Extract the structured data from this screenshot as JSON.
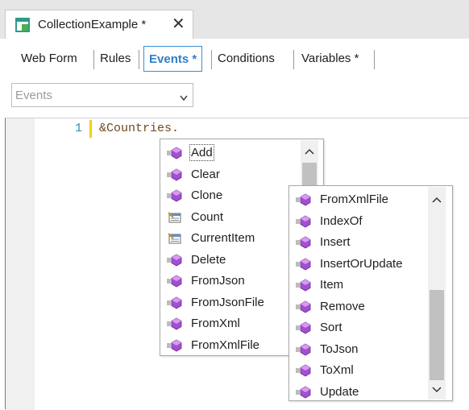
{
  "document_tab": {
    "title": "CollectionExample",
    "modified_marker": "*",
    "close_icon": "close-icon"
  },
  "subtabs": [
    {
      "label": "Web Form"
    },
    {
      "label": "Rules"
    },
    {
      "label": "Events *"
    },
    {
      "label": "Conditions"
    },
    {
      "label": "Variables *"
    }
  ],
  "events_combo": {
    "value": "Events"
  },
  "editor": {
    "line_number": "1",
    "code": "&Countries."
  },
  "completion_list_1": {
    "items": [
      {
        "label": "Add",
        "icon": "method-icon"
      },
      {
        "label": "Clear",
        "icon": "method-icon"
      },
      {
        "label": "Clone",
        "icon": "method-icon"
      },
      {
        "label": "Count",
        "icon": "property-icon"
      },
      {
        "label": "CurrentItem",
        "icon": "property-icon"
      },
      {
        "label": "Delete",
        "icon": "method-icon"
      },
      {
        "label": "FromJson",
        "icon": "method-icon"
      },
      {
        "label": "FromJsonFile",
        "icon": "method-icon"
      },
      {
        "label": "FromXml",
        "icon": "method-icon"
      },
      {
        "label": "FromXmlFile",
        "icon": "method-icon"
      }
    ]
  },
  "completion_list_2": {
    "items": [
      {
        "label": "FromXmlFile",
        "icon": "method-icon"
      },
      {
        "label": "IndexOf",
        "icon": "method-icon"
      },
      {
        "label": "Insert",
        "icon": "method-icon"
      },
      {
        "label": "InsertOrUpdate",
        "icon": "method-icon"
      },
      {
        "label": "Item",
        "icon": "method-icon"
      },
      {
        "label": "Remove",
        "icon": "method-icon"
      },
      {
        "label": "Sort",
        "icon": "method-icon"
      },
      {
        "label": "ToJson",
        "icon": "method-icon"
      },
      {
        "label": "ToXml",
        "icon": "method-icon"
      },
      {
        "label": "Update",
        "icon": "method-icon"
      }
    ]
  },
  "colors": {
    "accent": "#2e7fc9",
    "method_icon": "#9b4fc7",
    "line_number": "#2b91af",
    "code": "#6f4a1e"
  }
}
